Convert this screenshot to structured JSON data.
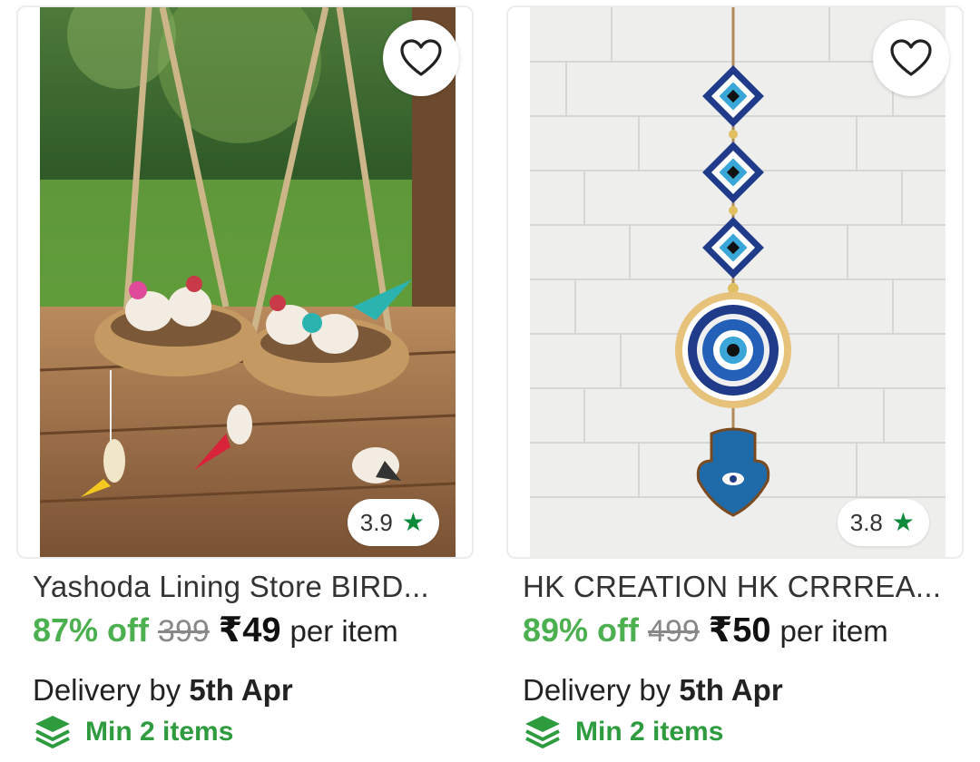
{
  "products": [
    {
      "image_alt": "Hanging jute bird nest decor with birds",
      "rating": "3.9",
      "title": "Yashoda Lining Store BIRD...",
      "discount": "87% off",
      "mrp": "399",
      "price": "₹49",
      "unit": "per item",
      "delivery_prefix": "Delivery by",
      "delivery_date": "5th Apr",
      "min_items": "Min 2 items",
      "wishlist_icon": "heart-outline-icon",
      "rating_icon": "star-icon"
    },
    {
      "image_alt": "Evil eye and hamsa wall hanging",
      "rating": "3.8",
      "title": "HK CREATION HK CRRREA...",
      "discount": "89% off",
      "mrp": "499",
      "price": "₹50",
      "unit": "per item",
      "delivery_prefix": "Delivery by",
      "delivery_date": "5th Apr",
      "min_items": "Min 2 items",
      "wishlist_icon": "heart-outline-icon",
      "rating_icon": "star-icon"
    }
  ],
  "colors": {
    "discount": "#4caf50",
    "rating_star": "#0a8a3a",
    "min_items": "#2e9c3e"
  }
}
